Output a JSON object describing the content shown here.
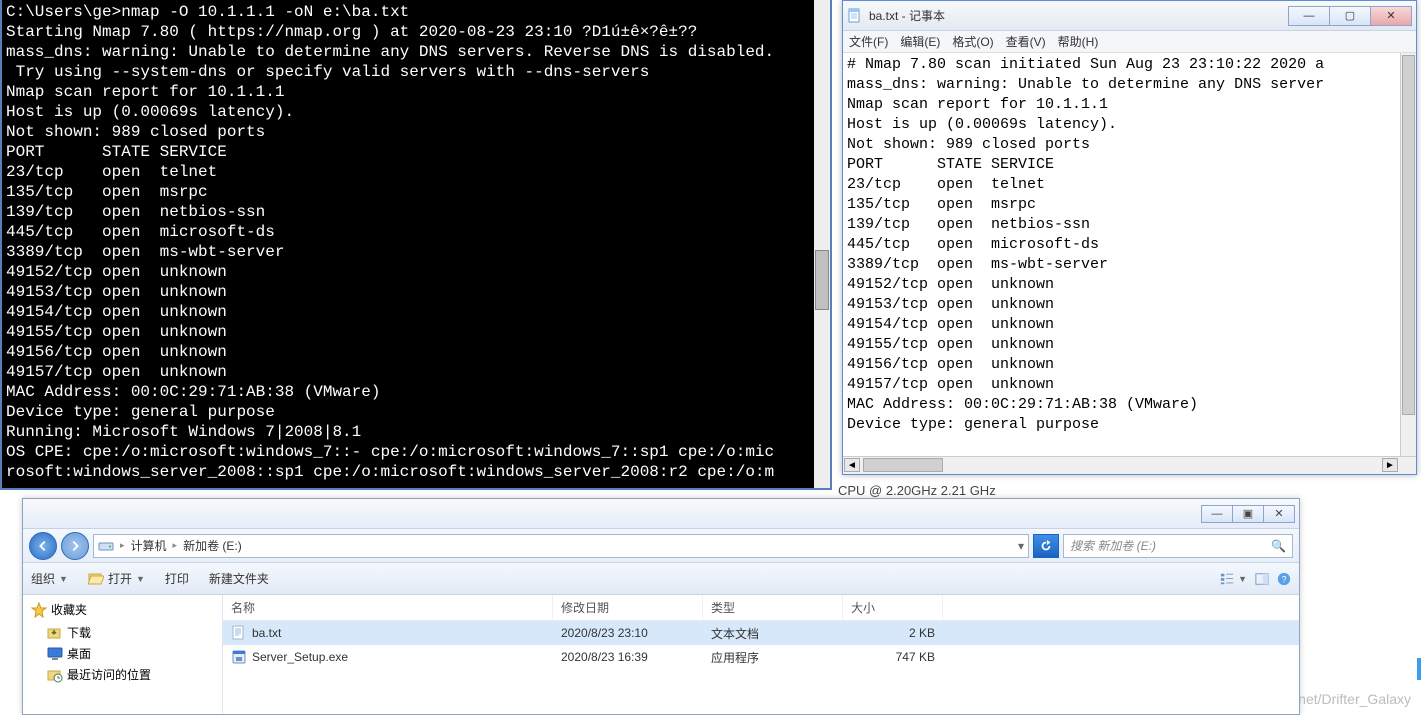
{
  "cmd": {
    "text": "C:\\Users\\ge>nmap -O 10.1.1.1 -oN e:\\ba.txt\nStarting Nmap 7.80 ( https://nmap.org ) at 2020-08-23 23:10 ?D1ú±ê×?ê±??\nmass_dns: warning: Unable to determine any DNS servers. Reverse DNS is disabled.\n Try using --system-dns or specify valid servers with --dns-servers\nNmap scan report for 10.1.1.1\nHost is up (0.00069s latency).\nNot shown: 989 closed ports\nPORT      STATE SERVICE\n23/tcp    open  telnet\n135/tcp   open  msrpc\n139/tcp   open  netbios-ssn\n445/tcp   open  microsoft-ds\n3389/tcp  open  ms-wbt-server\n49152/tcp open  unknown\n49153/tcp open  unknown\n49154/tcp open  unknown\n49155/tcp open  unknown\n49156/tcp open  unknown\n49157/tcp open  unknown\nMAC Address: 00:0C:29:71:AB:38 (VMware)\nDevice type: general purpose\nRunning: Microsoft Windows 7|2008|8.1\nOS CPE: cpe:/o:microsoft:windows_7::- cpe:/o:microsoft:windows_7::sp1 cpe:/o:mic\nrosoft:windows_server_2008::sp1 cpe:/o:microsoft:windows_server_2008:r2 cpe:/o:m"
  },
  "notepad": {
    "title": "ba.txt - 记事本",
    "menus": {
      "file": "文件(F)",
      "edit": "编辑(E)",
      "format": "格式(O)",
      "view": "查看(V)",
      "help": "帮助(H)"
    },
    "text": "# Nmap 7.80 scan initiated Sun Aug 23 23:10:22 2020 a\nmass_dns: warning: Unable to determine any DNS server\nNmap scan report for 10.1.1.1\nHost is up (0.00069s latency).\nNot shown: 989 closed ports\nPORT      STATE SERVICE\n23/tcp    open  telnet\n135/tcp   open  msrpc\n139/tcp   open  netbios-ssn\n445/tcp   open  microsoft-ds\n3389/tcp  open  ms-wbt-server\n49152/tcp open  unknown\n49153/tcp open  unknown\n49154/tcp open  unknown\n49155/tcp open  unknown\n49156/tcp open  unknown\n49157/tcp open  unknown\nMAC Address: 00:0C:29:71:AB:38 (VMware)\nDevice type: general purpose"
  },
  "explorer": {
    "breadcrumb": {
      "root_icon": "drive",
      "seg1": "计算机",
      "seg2": "新加卷 (E:)"
    },
    "search_placeholder": "搜索 新加卷 (E:)",
    "toolbar": {
      "organize": "组织",
      "open": "打开",
      "print": "打印",
      "newfolder": "新建文件夹"
    },
    "columns": {
      "name": "名称",
      "date": "修改日期",
      "type": "类型",
      "size": "大小"
    },
    "sidebar": {
      "favorites": "收藏夹",
      "downloads": "下载",
      "desktop": "桌面",
      "recent": "最近访问的位置"
    },
    "files": [
      {
        "name": "ba.txt",
        "date": "2020/8/23 23:10",
        "type": "文本文档",
        "size": "2 KB",
        "selected": true,
        "icon": "txt"
      },
      {
        "name": "Server_Setup.exe",
        "date": "2020/8/23 16:39",
        "type": "应用程序",
        "size": "747 KB",
        "selected": false,
        "icon": "exe"
      }
    ]
  },
  "bg": {
    "cpu": "CPU @ 2.20GHz  2.21 GHz",
    "watermark": "https://blog.csdn.net/Drifter_Galaxy"
  }
}
